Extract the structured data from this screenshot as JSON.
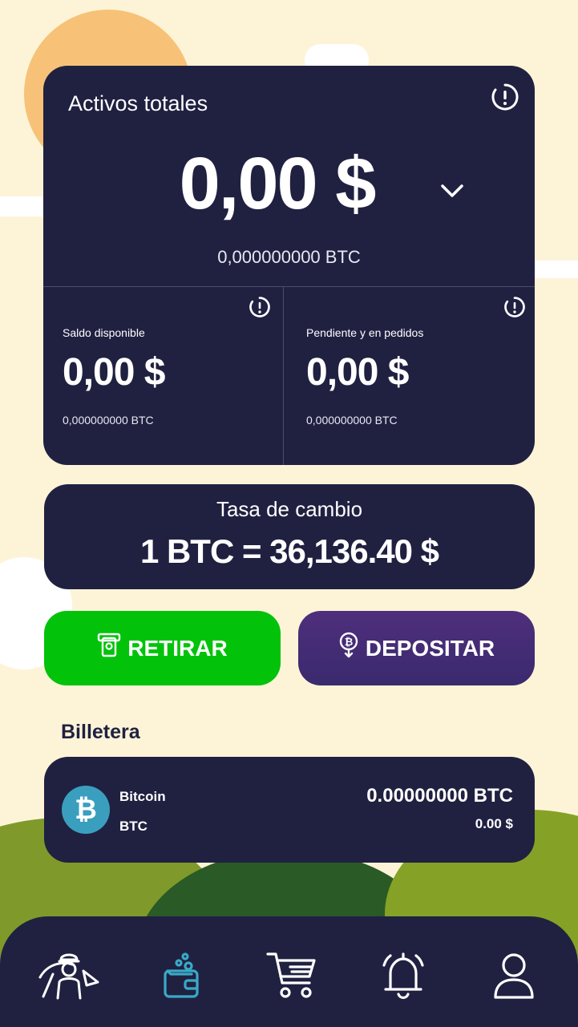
{
  "total_assets": {
    "title": "Activos totales",
    "amount": "0,00 $",
    "btc": "0,000000000 BTC"
  },
  "available": {
    "label": "Saldo disponible",
    "amount": "0,00 $",
    "btc": "0,000000000 BTC"
  },
  "pending": {
    "label": "Pendiente y en pedidos",
    "amount": "0,00 $",
    "btc": "0,000000000 BTC"
  },
  "exchange_rate": {
    "title": "Tasa de cambio",
    "value": "1 BTC = 36,136.40 $"
  },
  "actions": {
    "withdraw_label": "RETIRAR",
    "deposit_label": "DEPOSITAR"
  },
  "wallet": {
    "heading": "Billetera",
    "items": [
      {
        "name": "Bitcoin",
        "symbol": "BTC",
        "balance": "0.00000000 BTC",
        "fiat": "0.00 $",
        "icon": "bitcoin-icon",
        "color": "#3a9fbf"
      }
    ]
  },
  "nav": {
    "items": [
      {
        "icon": "miner-icon",
        "active": false
      },
      {
        "icon": "wallet-icon",
        "active": true
      },
      {
        "icon": "cart-icon",
        "active": false
      },
      {
        "icon": "bell-icon",
        "active": false
      },
      {
        "icon": "user-icon",
        "active": false
      }
    ]
  },
  "colors": {
    "background": "#fdf4d8",
    "card": "#202141",
    "withdraw": "#02c30a",
    "deposit": "#4f2e7c",
    "active_nav": "#3aa9c6"
  }
}
